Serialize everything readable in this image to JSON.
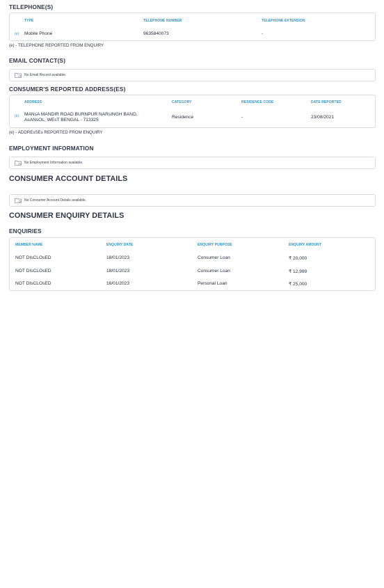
{
  "telephone": {
    "title": "TELEPHONE(S)",
    "headers": {
      "type": "TYPE",
      "number": "TELEPHONE NUMBER",
      "extension": "TELEPHONE EXTENSION"
    },
    "row": {
      "marker": "(e)",
      "type": "Mobile Phone",
      "number": "9635840073",
      "extension": "-"
    },
    "note": "(e) - TELEPHONE REPORTED FROM ENQUIRY"
  },
  "email": {
    "title": "EMAIL CONTACT(S)",
    "empty": "No Email Record available."
  },
  "address": {
    "title": "CONSUMER'S REPORTED ADDRESS(ES)",
    "headers": {
      "address": "ADDRESS",
      "category": "CATEGORY",
      "residence": "RESIDENCE CODE",
      "date": "DATE REPORTED"
    },
    "row": {
      "marker": "(e)",
      "line1": "MANsA MANDIR ROAD BURNPUR NARsINGH BAND,",
      "line2": "AsANsOL, WEsT BENGAL - 713325",
      "category": "Residence",
      "residence": "-",
      "date": "23/08/2021"
    },
    "note": "(e) - ADDREsSEs REPORTED FROM ENQUIRY"
  },
  "employment": {
    "title": "EMPLOYMENT INFORMATION",
    "empty": "No Employment Information available."
  },
  "account": {
    "title": "CONSUMER ACCOUNT DETAILS",
    "empty": "No Consumer Account Details available."
  },
  "enquiry": {
    "title": "CONSUMER ENQUIRY DETAILS",
    "subtitle": "ENQUIRIES",
    "headers": {
      "member": "MEMBER NAME",
      "date": "ENQUIRY DATE",
      "purpose": "ENQUIRY PURPOSE",
      "amount": "ENQUIRY AMOUNT"
    },
    "rows": [
      {
        "member": "NOT DIsCLOsED",
        "date": "18/01/2023",
        "purpose": "Consumer Loan",
        "amount": "₹ 20,000"
      },
      {
        "member": "NOT DIsCLOsED",
        "date": "18/01/2023",
        "purpose": "Consumer Loan",
        "amount": "₹ 12,999"
      },
      {
        "member": "NOT DIsCLOsED",
        "date": "16/01/2023",
        "purpose": "Personal Loan",
        "amount": "₹ 25,000"
      }
    ]
  },
  "colors": {
    "accent": "#2a93c9",
    "heading": "#2c3445",
    "border": "#d9dde3"
  }
}
